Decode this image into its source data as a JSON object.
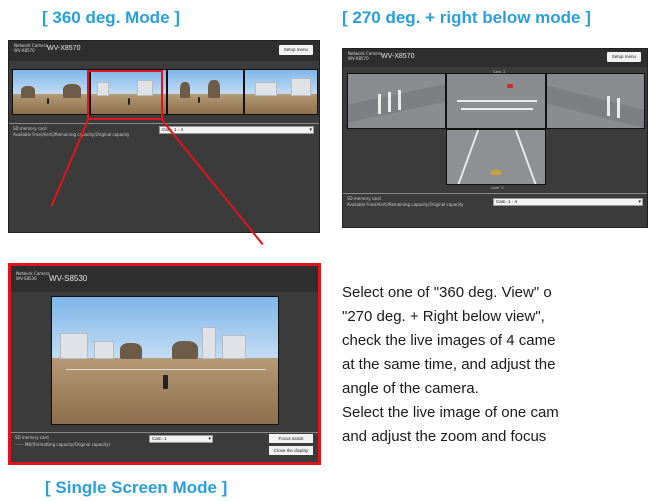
{
  "headings": {
    "mode_360": "[ 360 deg. Mode ]",
    "mode_270": "[ 270 deg. + right below mode ]",
    "mode_single": "[ Single Screen Mode ]"
  },
  "screens": {
    "mode_360": {
      "brand": "Network Camera\nWV-X8570",
      "model": "WV-X8570",
      "setup_label": "Setup menu",
      "sd_label": "SD memory card",
      "sd_detail": "Available Free(Alert)/Remaining capacity/Original capacity",
      "cam_select_value": "Cam. 1 - 4"
    },
    "mode_270": {
      "brand": "Network Camera\nWV-X8570",
      "model": "WV-X8570",
      "setup_label": "Setup menu",
      "cam2_label": "Cam. 2",
      "cam3_label": "Cam. 3",
      "sd_label": "SD memory card",
      "sd_detail": "Available Free(Alert)/Remaining capacity/Original capacity",
      "cam_select_value": "Cam. 1 - 4"
    },
    "mode_single": {
      "brand": "Network Camera\nWV-S8530",
      "model": "WV-S8530",
      "sd_label": "SD memory card",
      "sd_detail": "------ MB/(formatting capacity/Original capacity)",
      "cam_select_value": "Cam. 1",
      "focus_assist_label": "Focus assist",
      "close_display_label": "Close the display"
    }
  },
  "description": {
    "line1": "Select one of \"360 deg. View\" o",
    "line2": "\"270 deg. + Right below view\",",
    "line3": "check the live images of 4 came",
    "line4": "at the same time, and adjust the",
    "line5": "angle of the camera.",
    "line6": "Select the live image of one cam",
    "line7": "and adjust the zoom and focus"
  },
  "colors": {
    "heading": "#2a9fd8",
    "highlight": "#e0141c",
    "panel_bg": "#3b3b3b"
  }
}
